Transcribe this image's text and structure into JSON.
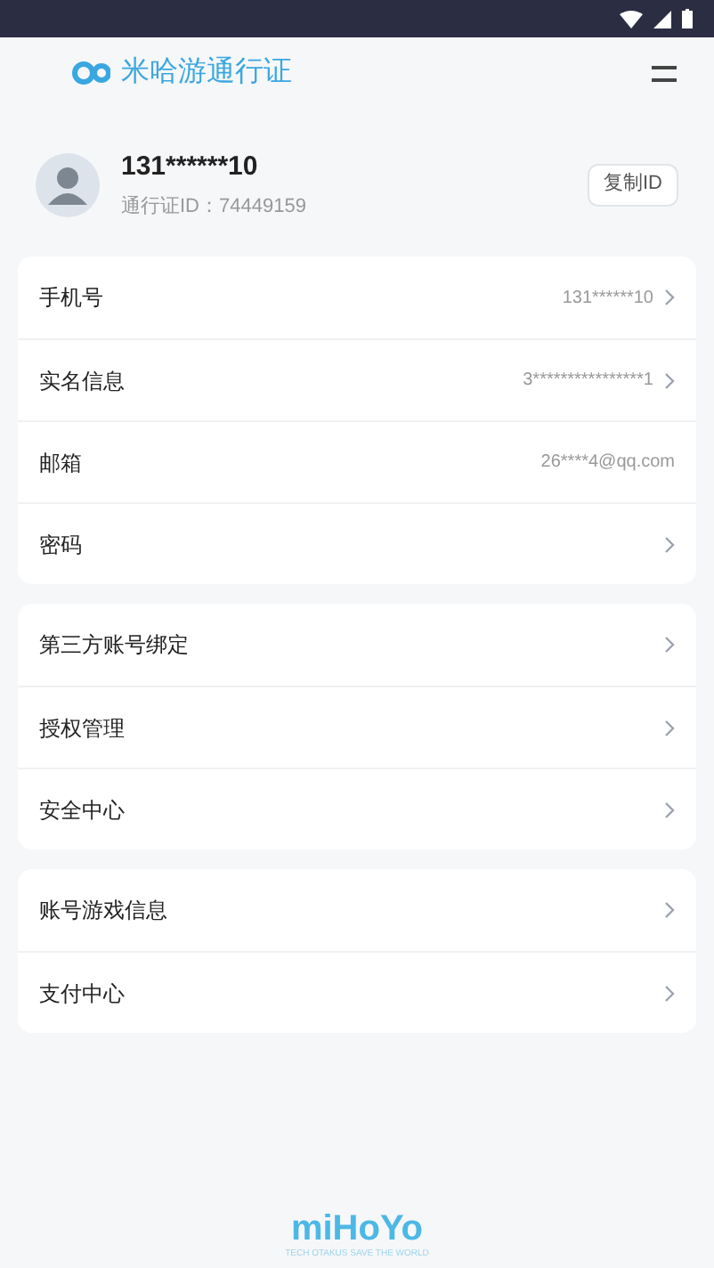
{
  "header": {
    "title": "米哈游通行证"
  },
  "profile": {
    "name": "131******10",
    "id_line": "通行证ID：74449159",
    "copy_button": "复制ID"
  },
  "groups": [
    {
      "rows": [
        {
          "label": "手机号",
          "value": "131******10",
          "chevron": true
        },
        {
          "label": "实名信息",
          "value": "3****************1",
          "chevron": true
        },
        {
          "label": "邮箱",
          "value": "26****4@qq.com",
          "chevron": false
        },
        {
          "label": "密码",
          "chevron": true
        }
      ]
    },
    {
      "rows": [
        {
          "label": "第三方账号绑定",
          "chevron": true
        },
        {
          "label": "授权管理",
          "chevron": true
        },
        {
          "label": "安全中心",
          "chevron": true
        }
      ]
    },
    {
      "rows": [
        {
          "label": "账号游戏信息",
          "chevron": true
        },
        {
          "label": "支付中心",
          "chevron": true
        }
      ]
    }
  ],
  "footer": {
    "logo": "miHoYo",
    "tagline": "TECH OTAKUS SAVE THE WORLD"
  }
}
